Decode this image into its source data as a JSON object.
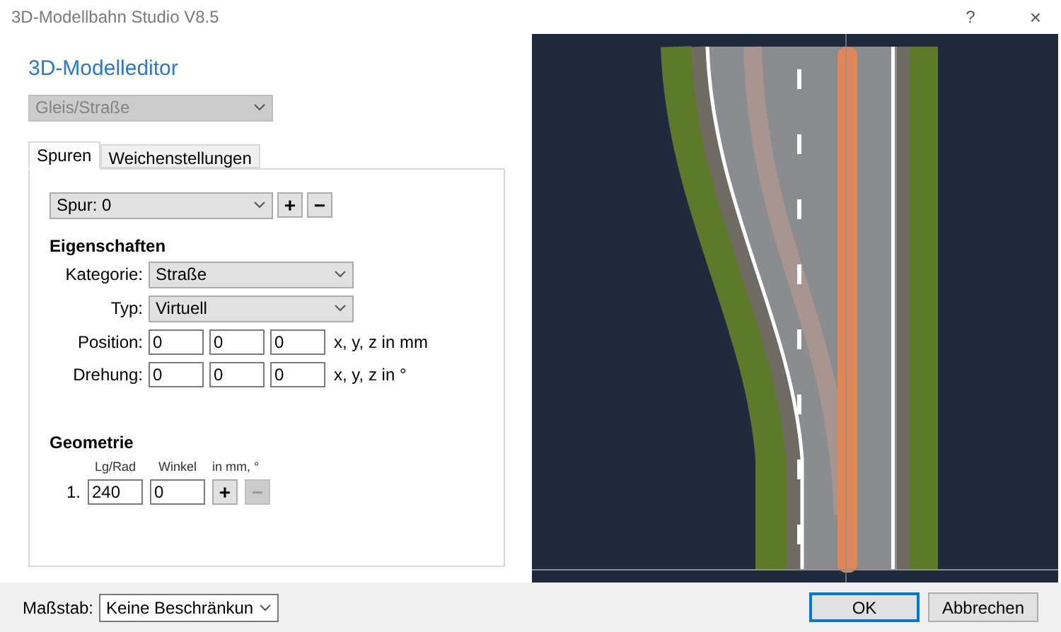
{
  "window": {
    "title": "3D-Modellbahn Studio V8.5",
    "help": "?",
    "close": "×"
  },
  "heading": "3D-Modelleditor",
  "model_type": {
    "value": "Gleis/Straße",
    "disabled": true
  },
  "tabs": [
    {
      "label": "Spuren",
      "selected": true
    },
    {
      "label": "Weichenstellungen",
      "selected": false
    }
  ],
  "lane": {
    "value": "Spur: 0",
    "add": {
      "label": "+",
      "disabled": false
    },
    "remove": {
      "label": "−",
      "disabled": false
    }
  },
  "properties": {
    "title": "Eigenschaften",
    "category": {
      "label": "Kategorie:",
      "value": "Straße"
    },
    "type": {
      "label": "Typ:",
      "value": "Virtuell"
    },
    "position": {
      "label": "Position:",
      "values": [
        "0",
        "0",
        "0"
      ],
      "unit": "x, y, z in mm"
    },
    "rotation": {
      "label": "Drehung:",
      "values": [
        "0",
        "0",
        "0"
      ],
      "unit": "x, y, z in °"
    }
  },
  "geometry": {
    "title": "Geometrie",
    "columns": [
      "Lg/Rad",
      "Winkel",
      "in mm, °"
    ],
    "rows": [
      {
        "index": "1.",
        "length": "240",
        "angle": "0"
      }
    ],
    "add": {
      "label": "+",
      "disabled": false
    },
    "remove": {
      "label": "−",
      "disabled": true
    }
  },
  "scale": {
    "label": "Maßstab:",
    "value": "Keine Beschränkun"
  },
  "buttons": [
    {
      "label": "OK",
      "kind": "default"
    },
    {
      "label": "Abbrechen",
      "kind": "normal"
    }
  ]
}
